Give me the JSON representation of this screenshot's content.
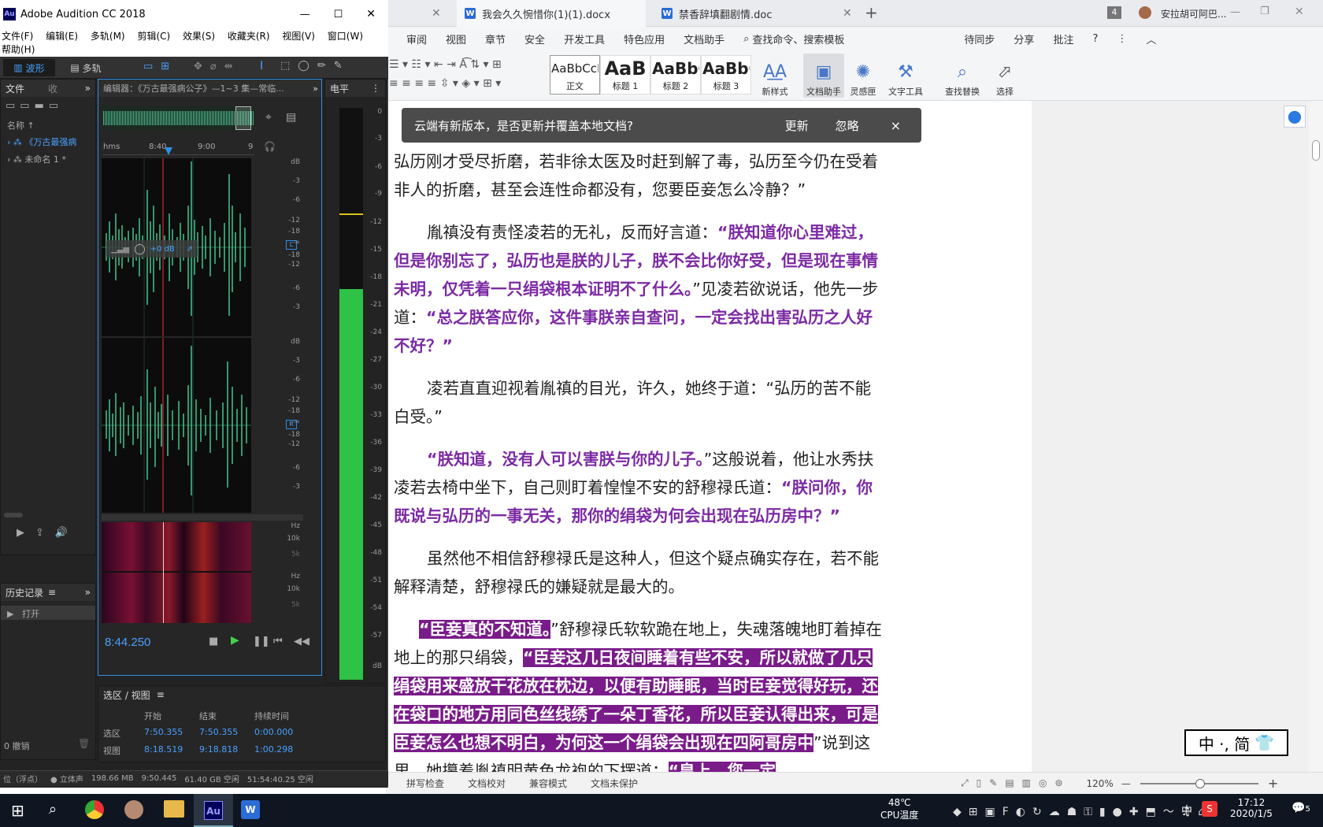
{
  "taskbar_top_tabs": {
    "tab1": "我会久久惋惜你(1)(1).docx",
    "tab2": "禁香辞填翻剧情.doc",
    "add": "+",
    "user_badge": "4",
    "user_name": "安拉胡可阿巴..."
  },
  "wps_menu": [
    "审阅",
    "视图",
    "章节",
    "安全",
    "开发工具",
    "特色应用",
    "文档助手",
    "查找命令、搜索模板"
  ],
  "wps_menu_right": [
    "待同步",
    "分享",
    "批注"
  ],
  "styles": [
    {
      "preview": "AaBbCcDd",
      "label": "正文"
    },
    {
      "preview": "AaB",
      "label": "标题 1"
    },
    {
      "preview": "AaBbC",
      "label": "标题 2"
    },
    {
      "preview": "AaBbC",
      "label": "标题 3"
    }
  ],
  "ribbon_buttons": [
    "新样式",
    "文档助手",
    "灵感匣",
    "文字工具",
    "查找替换",
    "选择"
  ],
  "notify": {
    "text": "云端有新版本，是否更新并覆盖本地文档?",
    "update": "更新",
    "ignore": "忽略",
    "close": "×"
  },
  "doc": {
    "p0a": "弘历刚才受尽折磨，若非徐太医及时赶到解了毒，弘历至今仍在受着非人的折磨，甚至会连性命都没有，您要臣妾怎么冷静？”",
    "p1a": "胤禛没有责怪凌若的无礼，反而好言道：",
    "p1b": "“朕知道你心里难过，但是你别忘了，弘历也是朕的儿子，朕不会比你好受，但是现在事情未明，仅凭着一只绢袋根本证明不了什么。",
    "p1c": "”见凌若欲说话，他先一步道：",
    "p1d": "“总之朕答应你，这件事朕亲自查问，一定会找出害弘历之人好不好？”",
    "p2": "凌若直直迎视着胤禛的目光，许久，她终于道：“弘历的苦不能白受。”",
    "p3a": "“朕知道，没有人可以害朕与你的儿子。",
    "p3b": "”这般说着，他让水秀扶凌若去椅中坐下，自己则盯着惶惶不安的舒穆禄氏道：",
    "p3c": "“朕问你，你既说与弘历的一事无关，那你的绢袋为何会出现在弘历房中？”",
    "p4": "虽然他不相信舒穆禄氏是这种人，但这个疑点确实存在，若不能解释清楚，舒穆禄氏的嫌疑就是最大的。",
    "p5a": "“臣妾真的不知道。",
    "p5b": "”舒穆禄氏软软跪在地上，失魂落魄地盯着掉在地上的那只绢袋，",
    "p5c": "“臣妾这几日夜间睡着有些不安，所以就做了几只绢袋用来盛放干花放在枕边，以便有助睡眠，当时臣妾觉得好玩，还在袋口的地方用同色丝线绣了一朵丁香花，所以臣妾认得出来，可是臣妾怎么也想不明白，为何这一个绢袋会出现在四阿哥房中",
    "p5d": "”说到这里，她攥着胤禛明黄色龙袍的下摆道：",
    "p5e": "“皇上，您一定"
  },
  "ime": {
    "label": "中 ·, 简"
  },
  "wps_status": {
    "spell": "拼写检查",
    "proof": "文档校对",
    "compat": "兼容模式",
    "protect": "文档未保护",
    "zoom": "120%"
  },
  "au": {
    "title": "Adobe Audition CC 2018",
    "menu": [
      "文件(F)",
      "编辑(E)",
      "多轨(M)",
      "剪辑(C)",
      "效果(S)",
      "收藏夹(R)",
      "视图(V)",
      "窗口(W)",
      "帮助(H)"
    ],
    "mode_wave": "波形",
    "mode_multi": "多轨",
    "files_tab": "文件",
    "files_tab2": "收",
    "name_col": "名称",
    "file1": "《万古最强病",
    "file2": "未命名 1 *",
    "editor_title": "编辑器：《万古最强病公子》—1~3 集—常临...",
    "level_title": "电平",
    "time_hms": "hms",
    "time_840": "8:40",
    "time_900": "9:00",
    "time_9": "9",
    "gain": "+0 dB",
    "current_time": "8:44.250",
    "history_title": "历史记录",
    "history_item": "打开",
    "undo": "0 撤销",
    "sel_title": "选区 / 视图",
    "col_start": "开始",
    "col_end": "结束",
    "col_dur": "持续时间",
    "row_sel": "选区",
    "row_view": "视图",
    "sel_start": "7:50.355",
    "sel_end": "7:50.355",
    "sel_dur": "0:00.000",
    "view_start": "8:18.519",
    "view_end": "9:18.818",
    "view_dur": "1:00.298",
    "status_rate": "位（浮点）",
    "status_stereo": "立体声",
    "status_mem": "198.66 MB",
    "status_len": "9:50.445",
    "status_free": "61.40 GB 空闲",
    "status_time": "51:54:40.25 空闲"
  },
  "taskbar": {
    "temp": "48℃",
    "temp_label": "CPU温度",
    "lang": "中",
    "time": "17:12",
    "date": "2020/1/5",
    "notif": "5"
  }
}
